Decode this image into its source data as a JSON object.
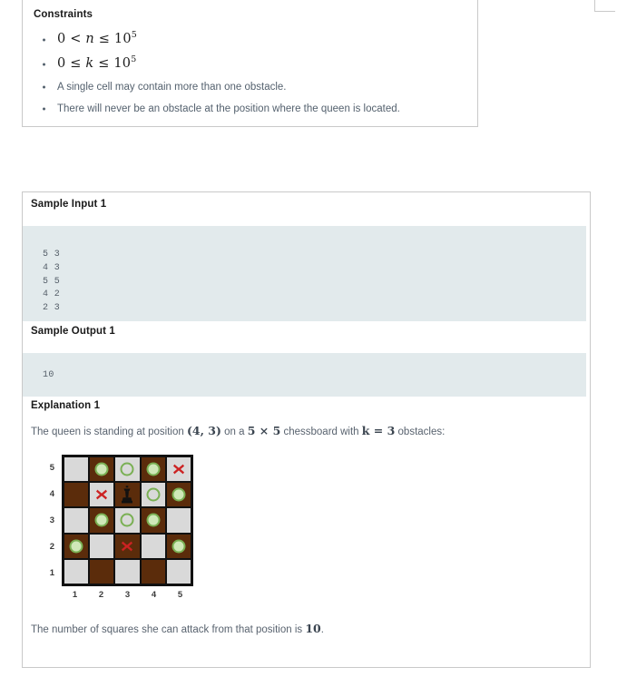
{
  "constraints": {
    "title": "Constraints",
    "items": [
      {
        "kind": "math",
        "text": "0 < n ≤ 10⁵",
        "lhs": "0 <",
        "var": "n",
        "rel": "≤ 10",
        "exp": "5"
      },
      {
        "kind": "math",
        "text": "0 ≤ k ≤ 10⁵",
        "lhs": "0 ≤",
        "var": "k",
        "rel": "≤ 10",
        "exp": "5"
      },
      {
        "kind": "plain",
        "text": "A single cell may contain more than one obstacle."
      },
      {
        "kind": "plain",
        "text": "There will never be an obstacle at the position where the queen is located."
      }
    ]
  },
  "sample": {
    "input_title": "Sample Input 1",
    "input_code": "5 3\n4 3\n5 5\n4 2\n2 3",
    "output_title": "Sample Output 1",
    "output_code": "10",
    "explanation_title": "Explanation 1",
    "explanation": {
      "part1": "The queen is standing at position ",
      "position": "(4, 3)",
      "part2": " on a ",
      "board_size": "5 × 5",
      "part3": " chessboard with ",
      "k_value": "k = 3",
      "part4": " obstacles:"
    },
    "summary": {
      "part1": "The number of squares she can attack from that position is ",
      "count": "10",
      "part2": "."
    }
  },
  "board": {
    "size": 5,
    "row_labels": [
      "5",
      "4",
      "3",
      "2",
      "1"
    ],
    "col_labels": [
      "1",
      "2",
      "3",
      "4",
      "5"
    ],
    "queen": {
      "col": 3,
      "row": 4
    },
    "colors": {
      "light_square": "#d9d9d9",
      "dark_square": "#5b2c0b",
      "attack_marker": "#7ab054",
      "attack_fill": "#cfe8b8",
      "obstacle_marker": "#cc2222",
      "border": "#111111"
    },
    "legend": {
      "attack": "attackable-square",
      "obstacle": "obstacle",
      "queen": "queen"
    },
    "cells": [
      [
        {
          "shade": "light",
          "marker": "none"
        },
        {
          "shade": "dark",
          "marker": "attack"
        },
        {
          "shade": "light",
          "marker": "attack"
        },
        {
          "shade": "dark",
          "marker": "attack"
        },
        {
          "shade": "light",
          "marker": "obstacle"
        }
      ],
      [
        {
          "shade": "dark",
          "marker": "none"
        },
        {
          "shade": "light",
          "marker": "obstacle"
        },
        {
          "shade": "dark",
          "marker": "queen"
        },
        {
          "shade": "light",
          "marker": "attack"
        },
        {
          "shade": "dark",
          "marker": "attack"
        }
      ],
      [
        {
          "shade": "light",
          "marker": "none"
        },
        {
          "shade": "dark",
          "marker": "attack"
        },
        {
          "shade": "light",
          "marker": "attack"
        },
        {
          "shade": "dark",
          "marker": "attack"
        },
        {
          "shade": "light",
          "marker": "none"
        }
      ],
      [
        {
          "shade": "dark",
          "marker": "attack"
        },
        {
          "shade": "light",
          "marker": "none"
        },
        {
          "shade": "dark",
          "marker": "obstacle"
        },
        {
          "shade": "light",
          "marker": "none"
        },
        {
          "shade": "dark",
          "marker": "attack"
        }
      ],
      [
        {
          "shade": "light",
          "marker": "none"
        },
        {
          "shade": "dark",
          "marker": "none"
        },
        {
          "shade": "light",
          "marker": "none"
        },
        {
          "shade": "dark",
          "marker": "none"
        },
        {
          "shade": "light",
          "marker": "none"
        }
      ]
    ]
  }
}
